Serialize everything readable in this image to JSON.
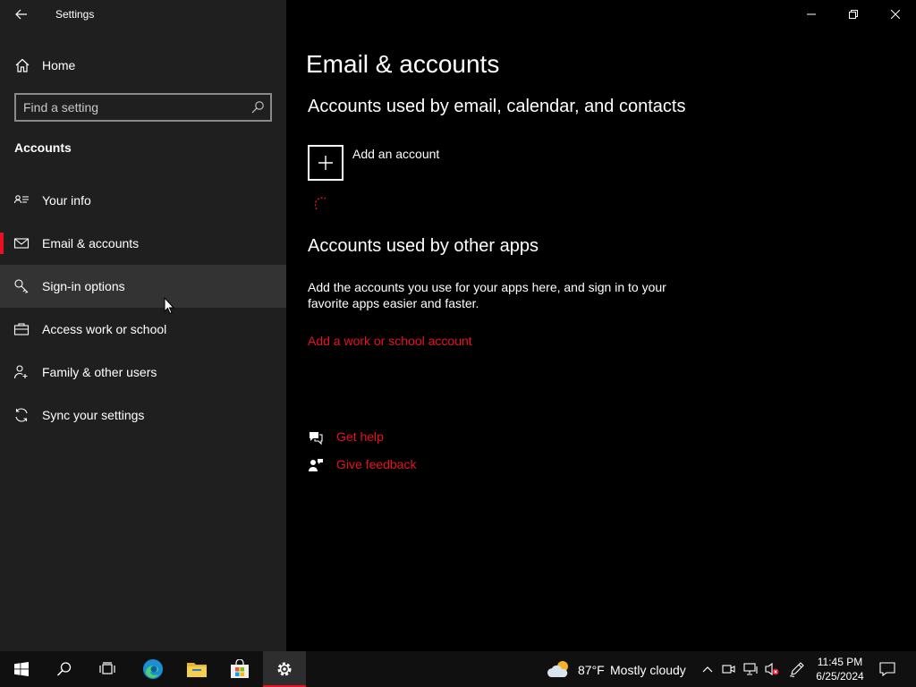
{
  "window": {
    "title": "Settings"
  },
  "sidebar": {
    "home_label": "Home",
    "search_placeholder": "Find a setting",
    "section_heading": "Accounts",
    "items": [
      {
        "label": "Your info",
        "icon": "contact-card-icon"
      },
      {
        "label": "Email & accounts",
        "icon": "mail-icon",
        "selected": true
      },
      {
        "label": "Sign-in options",
        "icon": "key-icon",
        "hovered": true
      },
      {
        "label": "Access work or school",
        "icon": "briefcase-icon"
      },
      {
        "label": "Family & other users",
        "icon": "add-person-icon"
      },
      {
        "label": "Sync your settings",
        "icon": "sync-icon"
      }
    ]
  },
  "main": {
    "page_title": "Email & accounts",
    "section1_heading": "Accounts used by email, calendar, and contacts",
    "add_account_label": "Add an account",
    "section2_heading": "Accounts used by other apps",
    "section2_description": "Add the accounts you use for your apps here, and sign in to your favorite apps easier and faster.",
    "add_work_link": "Add a work or school account",
    "help_links": {
      "get_help": "Get help",
      "give_feedback": "Give feedback"
    }
  },
  "taskbar": {
    "pinned": [
      "start-icon",
      "search-icon",
      "task-view-icon",
      "edge-icon",
      "file-explorer-icon",
      "store-icon",
      "settings-icon"
    ],
    "weather": {
      "temperature": "87°F",
      "condition": "Mostly cloudy"
    },
    "clock": {
      "time": "11:45 PM",
      "date": "6/25/2024"
    }
  },
  "colors": {
    "accent": "#e81123",
    "sidebar_bg": "#1f1f1f",
    "content_bg": "#000000",
    "hover_bg": "#333333",
    "taskbar_bg": "#101010"
  }
}
